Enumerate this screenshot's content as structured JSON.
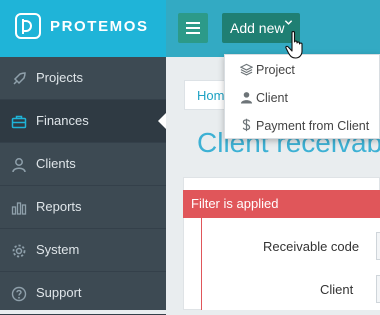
{
  "brand": {
    "name": "PROTEMOS"
  },
  "sidebar": {
    "items": [
      {
        "label": "Projects",
        "icon": "rocket-icon"
      },
      {
        "label": "Finances",
        "icon": "briefcase-icon",
        "active": true
      },
      {
        "label": "Clients",
        "icon": "person-icon"
      },
      {
        "label": "Reports",
        "icon": "bar-chart-icon"
      },
      {
        "label": "System",
        "icon": "gear-icon"
      },
      {
        "label": "Support",
        "icon": "question-icon"
      }
    ]
  },
  "topbar": {
    "add_new_label": "Add new"
  },
  "dropdown": {
    "items": [
      {
        "label": "Project",
        "icon": "layers-icon"
      },
      {
        "label": "Client",
        "icon": "user-icon"
      },
      {
        "label": "Payment from Client",
        "icon": "dollar-icon"
      }
    ]
  },
  "breadcrumb": {
    "home": "Hom"
  },
  "page": {
    "title": "Client receivab"
  },
  "filter": {
    "header": "Filter is applied",
    "fields": [
      {
        "label": "Receivable code"
      },
      {
        "label": "Client"
      }
    ]
  },
  "colors": {
    "brand": "#1fb4d8",
    "sidebar": "#3d4a53",
    "accent_green": "#1f7f73",
    "filter_red": "#e0565a"
  }
}
